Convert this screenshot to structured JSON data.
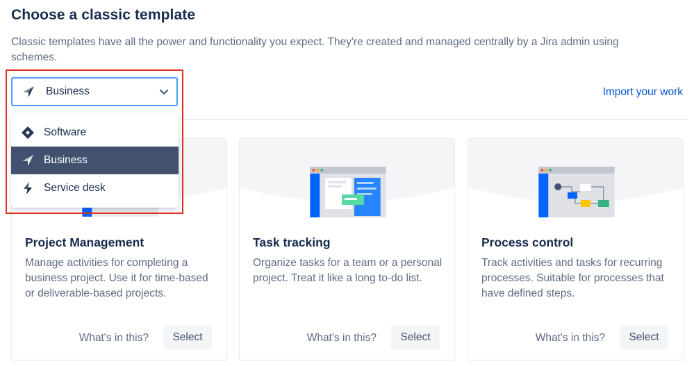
{
  "header": {
    "title": "Choose a classic template",
    "description": "Classic templates have all the power and functionality you expect. They're created and managed centrally by a Jira admin using schemes."
  },
  "selector": {
    "value": "Business",
    "icon": "business-icon",
    "options": [
      {
        "label": "Software",
        "icon": "software-icon",
        "selected": false
      },
      {
        "label": "Business",
        "icon": "business-icon",
        "selected": true
      },
      {
        "label": "Service desk",
        "icon": "service-desk-icon",
        "selected": false
      }
    ]
  },
  "import_link": "Import your work",
  "cards": [
    {
      "title": "Project Management",
      "description": "Manage activities for completing a business project. Use it for time-based or deliverable-based projects.",
      "whats_in": "What's in this?",
      "select": "Select"
    },
    {
      "title": "Task tracking",
      "description": "Organize tasks for a team or a personal project. Treat it like a long to-do list.",
      "whats_in": "What's in this?",
      "select": "Select"
    },
    {
      "title": "Process control",
      "description": "Track activities and tasks for recurring processes. Suitable for processes that have defined steps.",
      "whats_in": "What's in this?",
      "select": "Select"
    }
  ],
  "colors": {
    "accent": "#0052cc",
    "focus_border": "#4c9aff",
    "selected_option_bg": "#42526e",
    "annotation_box": "#e02f25"
  }
}
